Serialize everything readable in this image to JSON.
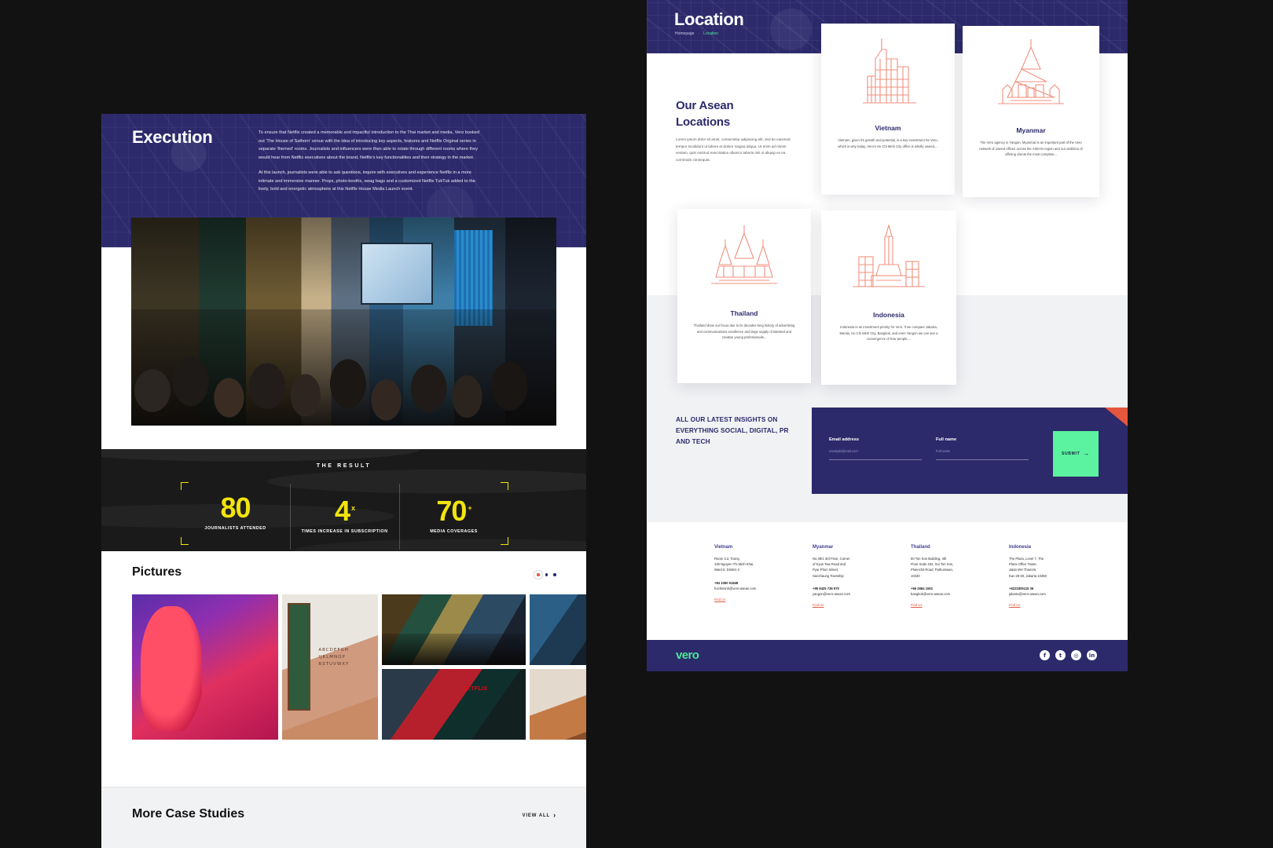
{
  "left_page": {
    "execution": {
      "title": "Execution",
      "paragraphs": [
        "To ensure that Netflix created a memorable and impactful introduction to the Thai market and media, Vero booked out 'The House of Sathorn' venue with the idea of introducing key aspects, features and Netflix Original series in separate 'themed' rooms. Journalists and influencers were then able to rotate through different rooms where they would hear from Netflix executives about the brand, Netflix's key functionalities and their strategy in the market.",
        "At this launch, journalists were able to ask questions, inquire with executives and experience Netflix in a more intimate and immersive manner. Props, photo-booths, swag bags and a customized Netflix TukTuk added to the lively, bold and energetic atmosphere at this Netflix House Media Launch event."
      ],
      "photo_alt": "Netflix House Media Launch event audience"
    },
    "result": {
      "label": "THE RESULT",
      "stats": [
        {
          "value": "80",
          "sup": "",
          "caption": "JOURNALISTS ATTENDED"
        },
        {
          "value": "4",
          "sup": "x",
          "caption": "TIMES INCREASE IN SUBSCRIPTION"
        },
        {
          "value": "70",
          "sup": "+",
          "caption": "MEDIA COVERAGES"
        }
      ]
    },
    "pictures": {
      "title": "Pictures",
      "dots": [
        "active",
        "inactive",
        "inactive"
      ],
      "items": [
        "neon pink installation room",
        "audience in themed room",
        "netflix press wall interview",
        "stranger things alphabet wall room",
        "presentation stage audience",
        "guest writing on paper"
      ]
    },
    "more_case_studies": {
      "title": "More Case Studies",
      "view_all": "VIEW ALL"
    }
  },
  "right_page": {
    "hero": {
      "title": "Location",
      "breadcrumb": {
        "home": "Homepage",
        "separator": "-",
        "current": "Location"
      }
    },
    "asean": {
      "heading_line1": "Our Asean",
      "heading_line2": "Locations",
      "intro": "Lorem ipsum dolor sit amet, consectetur adipiscing elit, sed do eiusmod tempor incididunt ut labore et dolore magna aliqua. Ut enim ad minim veniam, quis nostrud exercitation ullamco laboris nisi ut aliquip ex ea commodo consequat.",
      "cards": [
        {
          "name": "Vietnam",
          "icon": "vietnam-skyscraper-icon",
          "desc": "Vietnam, given it's growth and potential, is a key investment for Vero, which is why today, Vero's Ho Chi Minh City office is wholly owned,..."
        },
        {
          "name": "Myanmar",
          "icon": "myanmar-pagoda-icon",
          "desc": "The Vero agency in Yangon, Myanmar is an important part of the Vero network of owned offices across the ASEAN region and our ambition of offering clients the most complete..."
        },
        {
          "name": "Thailand",
          "icon": "thailand-temple-icon",
          "desc": "Thailand drew our focus due to its decades-long history of advertising and communications excellence and large supply of talented and creative young professionals..."
        },
        {
          "name": "Indonesia",
          "icon": "indonesia-monument-icon",
          "desc": "Indonesia is an investment priority for Vero. If we compare Jakarta, Manila, Ho Chi Minh City, Bangkok, and even Yangon we can see a convergence of how people,..."
        }
      ]
    },
    "newsletter": {
      "heading": "ALL OUR LATEST INSIGHTS ON EVERYTHING SOCIAL, DIGITAL, PR AND TECH",
      "email_label": "Email address",
      "email_placeholder": "example@mail.com",
      "name_label": "Full name",
      "name_placeholder": "Full name",
      "submit_label": "SUBMIT",
      "submit_arrow": "→",
      "accent_color": "#5bf2a0",
      "flag_color": "#e4573d"
    },
    "offices": [
      {
        "country": "Vietnam",
        "address": [
          "Room 3.2, Toong",
          "126 Nguyen Thi Minh Khai,",
          "Ward 6, District 3"
        ],
        "phone": "+84 3350 91848",
        "email": "hochiminh@vero-asean.com",
        "find_us": "Find Us"
      },
      {
        "country": "Myanmar",
        "address": [
          "No.49/1 3rd Floor, Corner",
          "of Kyun Taw Road and",
          "Pyar Phon Street,",
          "Sanchaung Township"
        ],
        "phone": "+95 9425 736 970",
        "email": "yangon@vero-asean.com",
        "find_us": "Find Us"
      },
      {
        "country": "Thailand",
        "address": [
          "50 Ton Son Building, 4th",
          "Floor Suite 402, Soi Ton Son,",
          "Ploenchit Road, Pathumwan,",
          "10330"
        ],
        "phone": "+66 2684 1551",
        "email": "bangkok@vero-asean.com",
        "find_us": "Find Us"
      },
      {
        "country": "Indonesia",
        "address": [
          "The Plaza, Level 7, The",
          "Plaza Office Tower,",
          "Jalan MH Thamrin,",
          "Kav 28-30, Jakarta 10350"
        ],
        "phone": "+6221805115 36",
        "email": "jakarta@vero-asean.com",
        "find_us": "Find Us"
      }
    ],
    "footer": {
      "logo": "vero",
      "socials": [
        {
          "name": "facebook-icon",
          "glyph": "f"
        },
        {
          "name": "twitter-icon",
          "glyph": "t"
        },
        {
          "name": "instagram-icon",
          "glyph": "◎"
        },
        {
          "name": "linkedin-icon",
          "glyph": "in"
        }
      ]
    }
  },
  "theme": {
    "navy": "#2c2a6b",
    "yellow": "#f2e40d",
    "green": "#4ee59a",
    "coral": "#e4573d",
    "background": "#121212"
  }
}
